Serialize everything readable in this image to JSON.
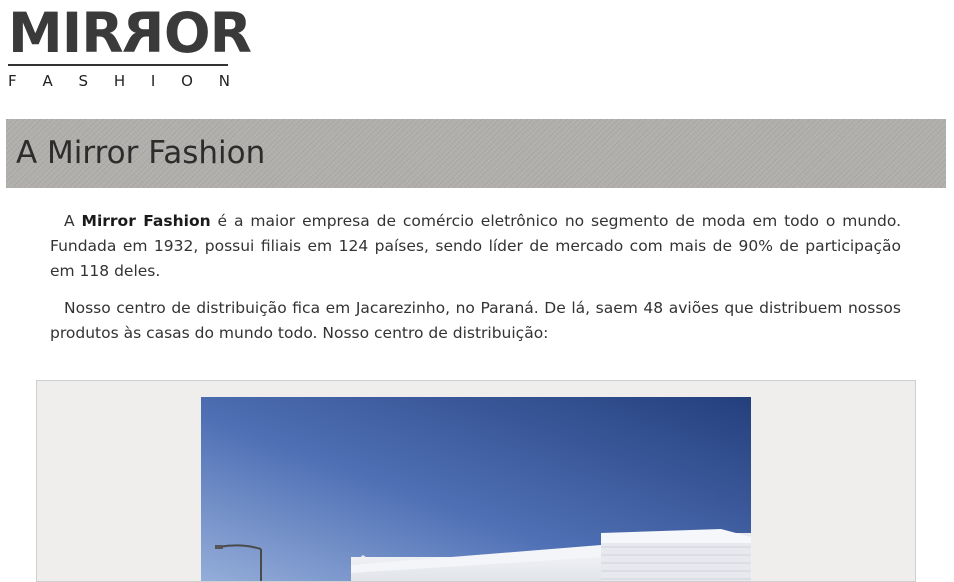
{
  "logo": {
    "word_prefix": "MIR",
    "word_flipped": "R",
    "word_suffix": "OR",
    "subtitle_letters": [
      "F",
      "A",
      "S",
      "H",
      "I",
      "O",
      "N"
    ]
  },
  "banner": {
    "title": "A Mirror Fashion"
  },
  "content": {
    "p1": {
      "intro": "A ",
      "brand": "Mirror Fashion",
      "rest": " é a maior empresa de comércio eletrônico no segmento de moda em todo o mundo. Fundada em 1932, possui filiais em 124 países, sendo líder de mercado com mais de 90% de participação em 118 deles."
    },
    "p2": "Nosso centro de distribuição fica em Jacarezinho, no Paraná. De lá, saem 48 aviões que distribuem nossos produtos às casas do mundo todo. Nosso centro de distribuição:"
  },
  "colors": {
    "banner_bg": "#b1afac",
    "figure_bg": "#f0eded",
    "sky_top": "#2c4a86",
    "sky_bottom": "#8fa9d6"
  }
}
